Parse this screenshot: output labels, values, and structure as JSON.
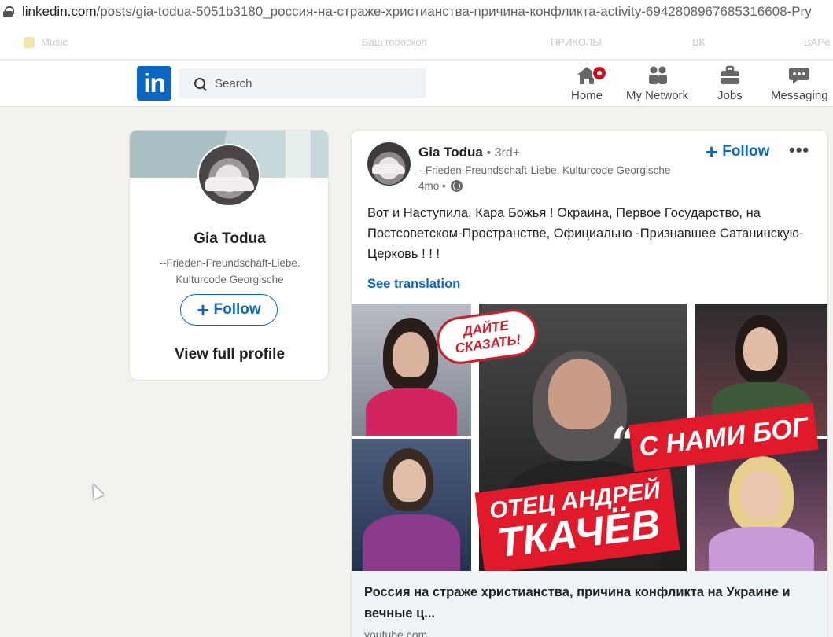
{
  "browser": {
    "url_domain": "linkedin.com",
    "url_path": "/posts/gia-todua-5051b3180_россия-на-страже-христианства-причина-конфликта-activity-6942808967685316608-Pry"
  },
  "bookmarks": {
    "items": [
      "Music",
      "Ваш гороскоп",
      "ПРИКОЛЫ",
      "ВК",
      "BAPe"
    ]
  },
  "header": {
    "logo": "in",
    "search_placeholder": "Search",
    "nav": [
      {
        "label": "Home",
        "icon": "home-icon"
      },
      {
        "label": "My Network",
        "icon": "network-icon"
      },
      {
        "label": "Jobs",
        "icon": "briefcase-icon"
      },
      {
        "label": "Messaging",
        "icon": "messaging-icon"
      }
    ]
  },
  "profile": {
    "name": "Gia Todua",
    "headline": "--Frieden-Freundschaft-Liebe. Kulturcode Georgische",
    "follow_label": "Follow",
    "view_full_label": "View full profile"
  },
  "post": {
    "author": "Gia Todua",
    "degree": "• 3rd+",
    "headline": "--Frieden-Freundschaft-Liebe. Kulturcode Georgische",
    "time": "4mo •",
    "follow_label": "Follow",
    "more_label": "•••",
    "text": "Вот и Наступила, Кара Божья ! Окраина, Первое Государство, на Постсоветском-Пространстве, Официально -Признавшее Сатанинскую-Церковь ! ! !",
    "see_translation": "See translation",
    "thumbnail": {
      "badge_text": "ДАЙТЕ СКАЗАТЬ!",
      "quote_mark": "“",
      "quote_text": "С НАМИ БОГ",
      "name_line1": "ОТЕЦ АНДРЕЙ",
      "name_line2": "ТКАЧЁВ"
    },
    "link_title": "Россия на страже христианства, причина конфликта на Украине и вечные ц...",
    "link_source": "youtube.com"
  },
  "colors": {
    "linkedin_blue": "#0a66c2",
    "notification_red": "#cc1016",
    "thumb_red": "#e01a2b"
  }
}
